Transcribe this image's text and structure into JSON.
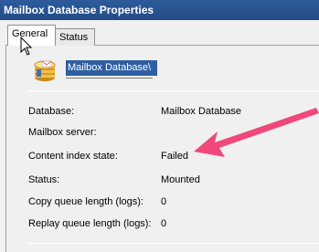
{
  "window": {
    "title": "Mailbox Database Properties"
  },
  "tabs": [
    {
      "label": "General",
      "active": true
    },
    {
      "label": "Status",
      "active": false
    }
  ],
  "header": {
    "name_value": "Mailbox Database\\",
    "icon": "database-icon"
  },
  "properties": [
    {
      "label": "Database:",
      "value": "Mailbox Database"
    },
    {
      "label": "Mailbox server:",
      "value": ""
    },
    {
      "label": "Content index state:",
      "value": "Failed"
    },
    {
      "label": "Status:",
      "value": "Mounted"
    },
    {
      "label": "Copy queue length (logs):",
      "value": "0"
    },
    {
      "label": "Replay queue length (logs):",
      "value": "0"
    }
  ],
  "annotation": {
    "icon": "pink-arrow",
    "color": "#f0487a"
  },
  "colors": {
    "titlebar": "#2d5b9c",
    "selection": "#2e5fa3"
  }
}
